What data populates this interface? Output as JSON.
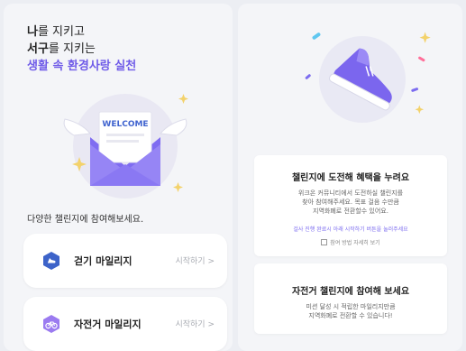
{
  "left": {
    "headline": {
      "line1_bold": "나",
      "line1_rest": "를 지키고",
      "line2_bold": "서구",
      "line2_rest": "를 지키는",
      "line3": "생활 속 환경사랑 실천"
    },
    "envelope_text": "WELCOME",
    "section_title": "다양한 챌린지에 참여해보세요.",
    "cards": [
      {
        "label": "걷기 마일리지",
        "action": "시작하기 >",
        "icon": "shoe-icon"
      },
      {
        "label": "자전거 마일리지",
        "action": "시작하기 >",
        "icon": "bicycle-icon"
      }
    ]
  },
  "right": {
    "card1": {
      "title": "챌린지에 도전해 혜택을 누려요",
      "desc_line1": "위크온 커뮤니티에서 도전하실 챌린지를",
      "desc_line2": "찾아 참여해주세요. 목표 걸음 수만큼",
      "desc_line3": "지역화폐로 전환할수 있어요.",
      "note": "걸사 진행 완료시 아래 시작하기 버튼을 눌러주세요",
      "link": "참여 방법 자세히 보기"
    },
    "card2": {
      "title": "자전거 챌린지에 참여해 보세요",
      "desc_line1": "미션 달성 시 적립한 마일리지만큼",
      "desc_line2": "지역화폐로 전환할 수 있습니다!"
    }
  },
  "colors": {
    "accent": "#6f5be8",
    "walk_icon": "#3d63c9",
    "bike_icon": "#9b7bf0"
  }
}
